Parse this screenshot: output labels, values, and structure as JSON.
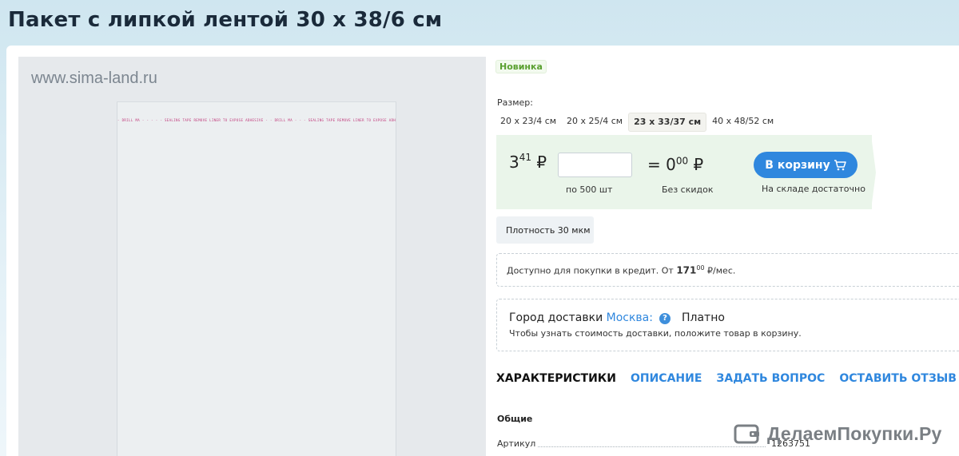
{
  "product": {
    "title": "Пакет с липкой лентой 30 х 38/6 см",
    "watermark": "www.sima-land.ru",
    "tape_print": "- DRILL MA - - - - - SEALING TAPE REMOVE LINER TO EXPOSE ADHESIVE - - DRILL MA - - - SEALING TAPE REMOVE LINER TO EXPOSE ADHESIVE - - DRILL MA"
  },
  "badge_new": "Новинка",
  "size": {
    "label": "Размер:",
    "options": [
      "20 х 23/4 см",
      "20 х 25/4 см",
      "23 х 33/37 см",
      "40 х 48/52 см"
    ],
    "selected_index": 2
  },
  "buy": {
    "price_int": "3",
    "price_frac": "41",
    "currency": "₽",
    "qty_value": "",
    "per_pack": "по 500 шт",
    "total_prefix": "= 0",
    "total_frac": "00",
    "no_discount": "Без скидок",
    "cart_button": "В корзину",
    "stock": "На складе достаточно"
  },
  "density": "Плотность 30 мкм",
  "credit": {
    "text_before": "Доступно для покупки в кредит. От ",
    "amount": "171",
    "amount_frac": "00",
    "text_after": " ₽/мес."
  },
  "delivery": {
    "label": "Город доставки ",
    "city": "Москва:",
    "help": "?",
    "cost": "Платно",
    "note": "Чтобы узнать стоимость доставки, положите товар в корзину."
  },
  "tabs": [
    "ХАРАКТЕРИСТИКИ",
    "ОПИСАНИЕ",
    "ЗАДАТЬ ВОПРОС",
    "ОСТАВИТЬ ОТЗЫВ"
  ],
  "specs": {
    "section": "Общие",
    "rows": [
      {
        "key": "Артикул",
        "value": "1263751"
      }
    ]
  },
  "brand": "ДелаемПокупки.Ру",
  "colors": {
    "accent": "#2f87de",
    "buy_panel": "#eaf5ea",
    "new_badge": "#5aa030"
  }
}
